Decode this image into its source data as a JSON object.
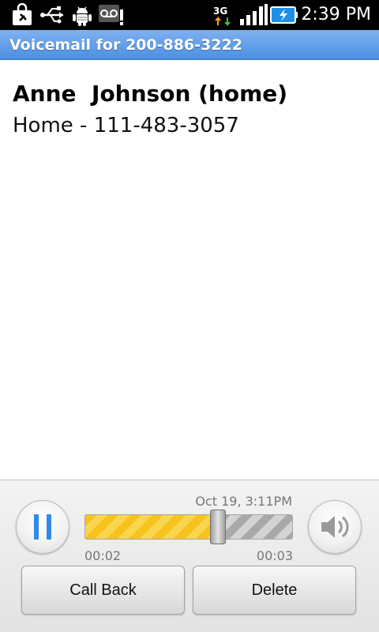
{
  "status_bar": {
    "icons": [
      "shopping-bag-icon",
      "usb-icon",
      "android-debug-icon",
      "voicemail-alert-icon",
      "3g-data-icon",
      "signal-bars-icon",
      "battery-charging-icon"
    ],
    "network": "3G",
    "time": "2:39 PM"
  },
  "header": {
    "title": "Voicemail for 200-886-3222",
    "color": "#5a9aea"
  },
  "contact": {
    "name": "Anne  Johnson (home)",
    "number": "Home - 111-483-3057"
  },
  "player": {
    "timestamp": "Oct 19, 3:11PM",
    "elapsed": "00:02",
    "total": "00:03",
    "progress_fraction": 0.64,
    "progress_color": "#f6c21c",
    "pause_icon": "pause-icon",
    "volume_icon": "speaker-icon"
  },
  "actions": {
    "call_back": "Call Back",
    "delete": "Delete"
  }
}
